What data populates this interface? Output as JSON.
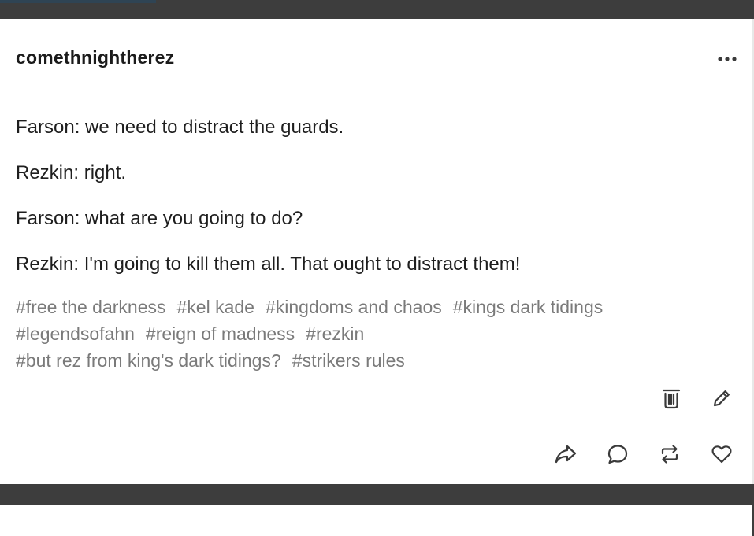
{
  "post": {
    "blog_name": "comethnightherez",
    "lines": [
      "Farson: we need to distract the guards.",
      "Rezkin: right.",
      "Farson: what are you going to do?",
      "Rezkin: I'm going to kill them all. That ought to distract them!"
    ],
    "tags": [
      "#free the darkness",
      "#kel kade",
      "#kingdoms and chaos",
      "#kings dark tidings",
      "#legendsofahn",
      "#reign of madness",
      "#rezkin",
      "#but rez from king's dark tidings?",
      "#strikers rules"
    ]
  },
  "icons": {
    "more": "more-options-icon",
    "delete": "trash-icon",
    "edit": "pencil-icon",
    "share": "share-icon",
    "reply": "reply-bubble-icon",
    "reblog": "reblog-icon",
    "like": "heart-icon"
  },
  "colors": {
    "dashboard_bg": "#3d3d3d",
    "card_bg": "#ffffff",
    "text": "#1e1e1e",
    "tag_text": "#7a7a7a"
  }
}
